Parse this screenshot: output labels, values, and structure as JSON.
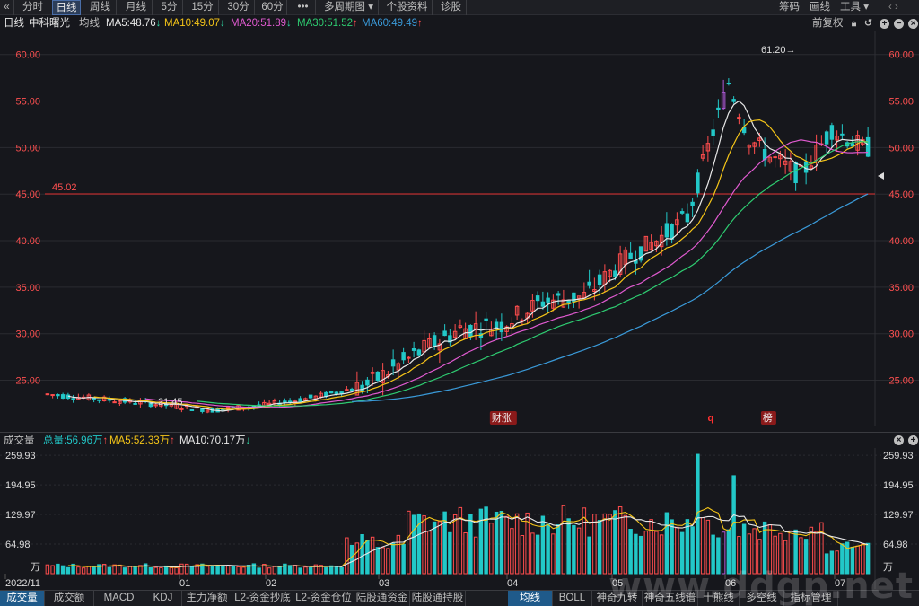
{
  "toolbar": {
    "back_icon": "double-chevron-left-icon",
    "tabs": [
      {
        "label": "分时",
        "active": false
      },
      {
        "label": "日线",
        "active": true
      },
      {
        "label": "周线",
        "active": false
      },
      {
        "label": "月线",
        "active": false
      },
      {
        "label": "5分",
        "active": false
      },
      {
        "label": "15分",
        "active": false
      },
      {
        "label": "30分",
        "active": false
      },
      {
        "label": "60分",
        "active": false
      },
      {
        "label": "•••",
        "active": false
      },
      {
        "label": "多周期图 ▾",
        "active": false
      },
      {
        "label": "个股资料",
        "active": false
      },
      {
        "label": "诊股",
        "active": false
      }
    ],
    "right": {
      "chips": "筹码",
      "draw": "画线",
      "tools": "工具 ▾"
    }
  },
  "ma_bar": {
    "period": "日线",
    "name": "中科曙光",
    "type": "均线",
    "items": [
      {
        "text": "MA5:48.76",
        "arrow": "↓",
        "color": "#e8e8e8",
        "dir": "down"
      },
      {
        "text": "MA10:49.07",
        "arrow": "↓",
        "color": "#f5c518",
        "dir": "down"
      },
      {
        "text": "MA20:51.89",
        "arrow": "↓",
        "color": "#e05ad0",
        "dir": "down"
      },
      {
        "text": "MA30:51.52",
        "arrow": "↑",
        "color": "#2ecc71",
        "dir": "up"
      },
      {
        "text": "MA60:49.49",
        "arrow": "↑",
        "color": "#3a9ad9",
        "dir": "up"
      }
    ],
    "right_label": "前复权",
    "icons": [
      "lock-icon",
      "undo-icon",
      "zoom-in-icon",
      "zoom-out-icon",
      "close-icon"
    ]
  },
  "colors": {
    "up": "#ff4d4d",
    "down": "#22c8c8",
    "special": "#b05ad8",
    "bg": "#16171c",
    "grid": "#2a2b30"
  },
  "chart_data": [
    {
      "type": "candlestick",
      "y_ticks": [
        "60.00",
        "55.00",
        "50.00",
        "45.00",
        "40.00",
        "35.00",
        "30.00",
        "25.00"
      ],
      "y_range": [
        21,
        62
      ],
      "reference_line": {
        "value": 45.02,
        "label": "45.02"
      },
      "high_annotation": {
        "label": "61.20→",
        "value": 61.2
      },
      "low_annotation": {
        "label": "←21.45",
        "value": 21.45
      },
      "event_markers": [
        {
          "label": "财涨",
          "x": 0.535
        },
        {
          "label": "q",
          "x": 0.77
        },
        {
          "label": "榜",
          "x": 0.83
        }
      ],
      "x_labels": [
        "2022/11",
        "01",
        "02",
        "03",
        "04",
        "05",
        "06",
        "07"
      ],
      "moving_averages": [
        "MA5",
        "MA10",
        "MA20",
        "MA30",
        "MA60"
      ]
    },
    {
      "type": "bar",
      "title": "成交量",
      "summary": [
        {
          "text": "总量:56.96万",
          "arrow": "↑",
          "color": "#22c8c8",
          "dir": "up"
        },
        {
          "text": "MA5:52.33万",
          "arrow": "↑",
          "color": "#f5c518",
          "dir": "up"
        },
        {
          "text": "MA10:70.17万",
          "arrow": "↓",
          "color": "#e8e8e8",
          "dir": "down"
        }
      ],
      "y_ticks": [
        "259.93",
        "194.95",
        "129.97",
        "64.98"
      ],
      "unit": "万",
      "y_range": [
        0,
        270
      ]
    }
  ],
  "bottom_tabs": {
    "left": [
      {
        "label": "成交量",
        "active": true
      },
      {
        "label": "成交额",
        "active": false
      },
      {
        "label": "MACD",
        "active": false
      },
      {
        "label": "KDJ",
        "active": false
      },
      {
        "label": "主力净额",
        "active": false
      },
      {
        "label": "L2-资金抄底",
        "active": false
      },
      {
        "label": "L2-资金仓位",
        "active": false
      },
      {
        "label": "陆股通资金",
        "active": false
      },
      {
        "label": "陆股通持股",
        "active": false
      }
    ],
    "right": [
      {
        "label": "均线",
        "active": true
      },
      {
        "label": "BOLL",
        "active": false
      },
      {
        "label": "神奇九转",
        "active": false
      },
      {
        "label": "神奇五线谱",
        "active": false
      },
      {
        "label": "十熊线",
        "active": false
      },
      {
        "label": "多空线",
        "active": false
      },
      {
        "label": "指标管理",
        "active": false
      }
    ]
  },
  "watermark": "www.ddgp.net"
}
